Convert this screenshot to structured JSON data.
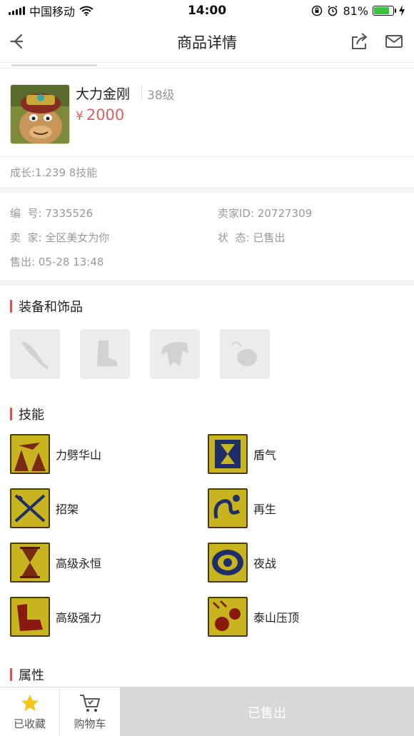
{
  "status_bar": {
    "carrier": "中国移动",
    "time": "14:00",
    "battery_text": "81%",
    "battery_level": 0.81
  },
  "nav": {
    "title": "商品详情",
    "icons": [
      "back-arrow-icon",
      "share-icon",
      "mail-icon"
    ]
  },
  "product": {
    "name": "大力金刚",
    "level": "38级",
    "currency": "¥",
    "price": "2000",
    "growth": "成长:1.239 8技能"
  },
  "info": {
    "id_label": "编  号:",
    "id_value": "7335526",
    "seller_id_label": "卖家ID:",
    "seller_id_value": "20727309",
    "seller_label": "卖  家:",
    "seller_value": "全区美女为你",
    "status_label": "状  态:",
    "status_value": "已售出",
    "sold_label": "售出:",
    "sold_value": "05-28 13:48"
  },
  "equipment": {
    "title": "装备和饰品",
    "slots": [
      "weapon-slot-icon",
      "boots-slot-icon",
      "armor-slot-icon",
      "accessory-slot-icon"
    ]
  },
  "skills": {
    "title": "技能",
    "items": [
      {
        "name": "力劈华山"
      },
      {
        "name": "盾气"
      },
      {
        "name": "招架"
      },
      {
        "name": "再生"
      },
      {
        "name": "高级永恒"
      },
      {
        "name": "夜战"
      },
      {
        "name": "高级强力"
      },
      {
        "name": "泰山压顶"
      }
    ]
  },
  "attributes": {
    "title": "属性"
  },
  "bottom_bar": {
    "favorite_label": "已收藏",
    "cart_label": "购物车",
    "sold_label": "已售出"
  },
  "colors": {
    "price": "#e06060",
    "accent_bar": "#e05050",
    "sold_button": "#d8d8d8",
    "star": "#f5c518"
  }
}
